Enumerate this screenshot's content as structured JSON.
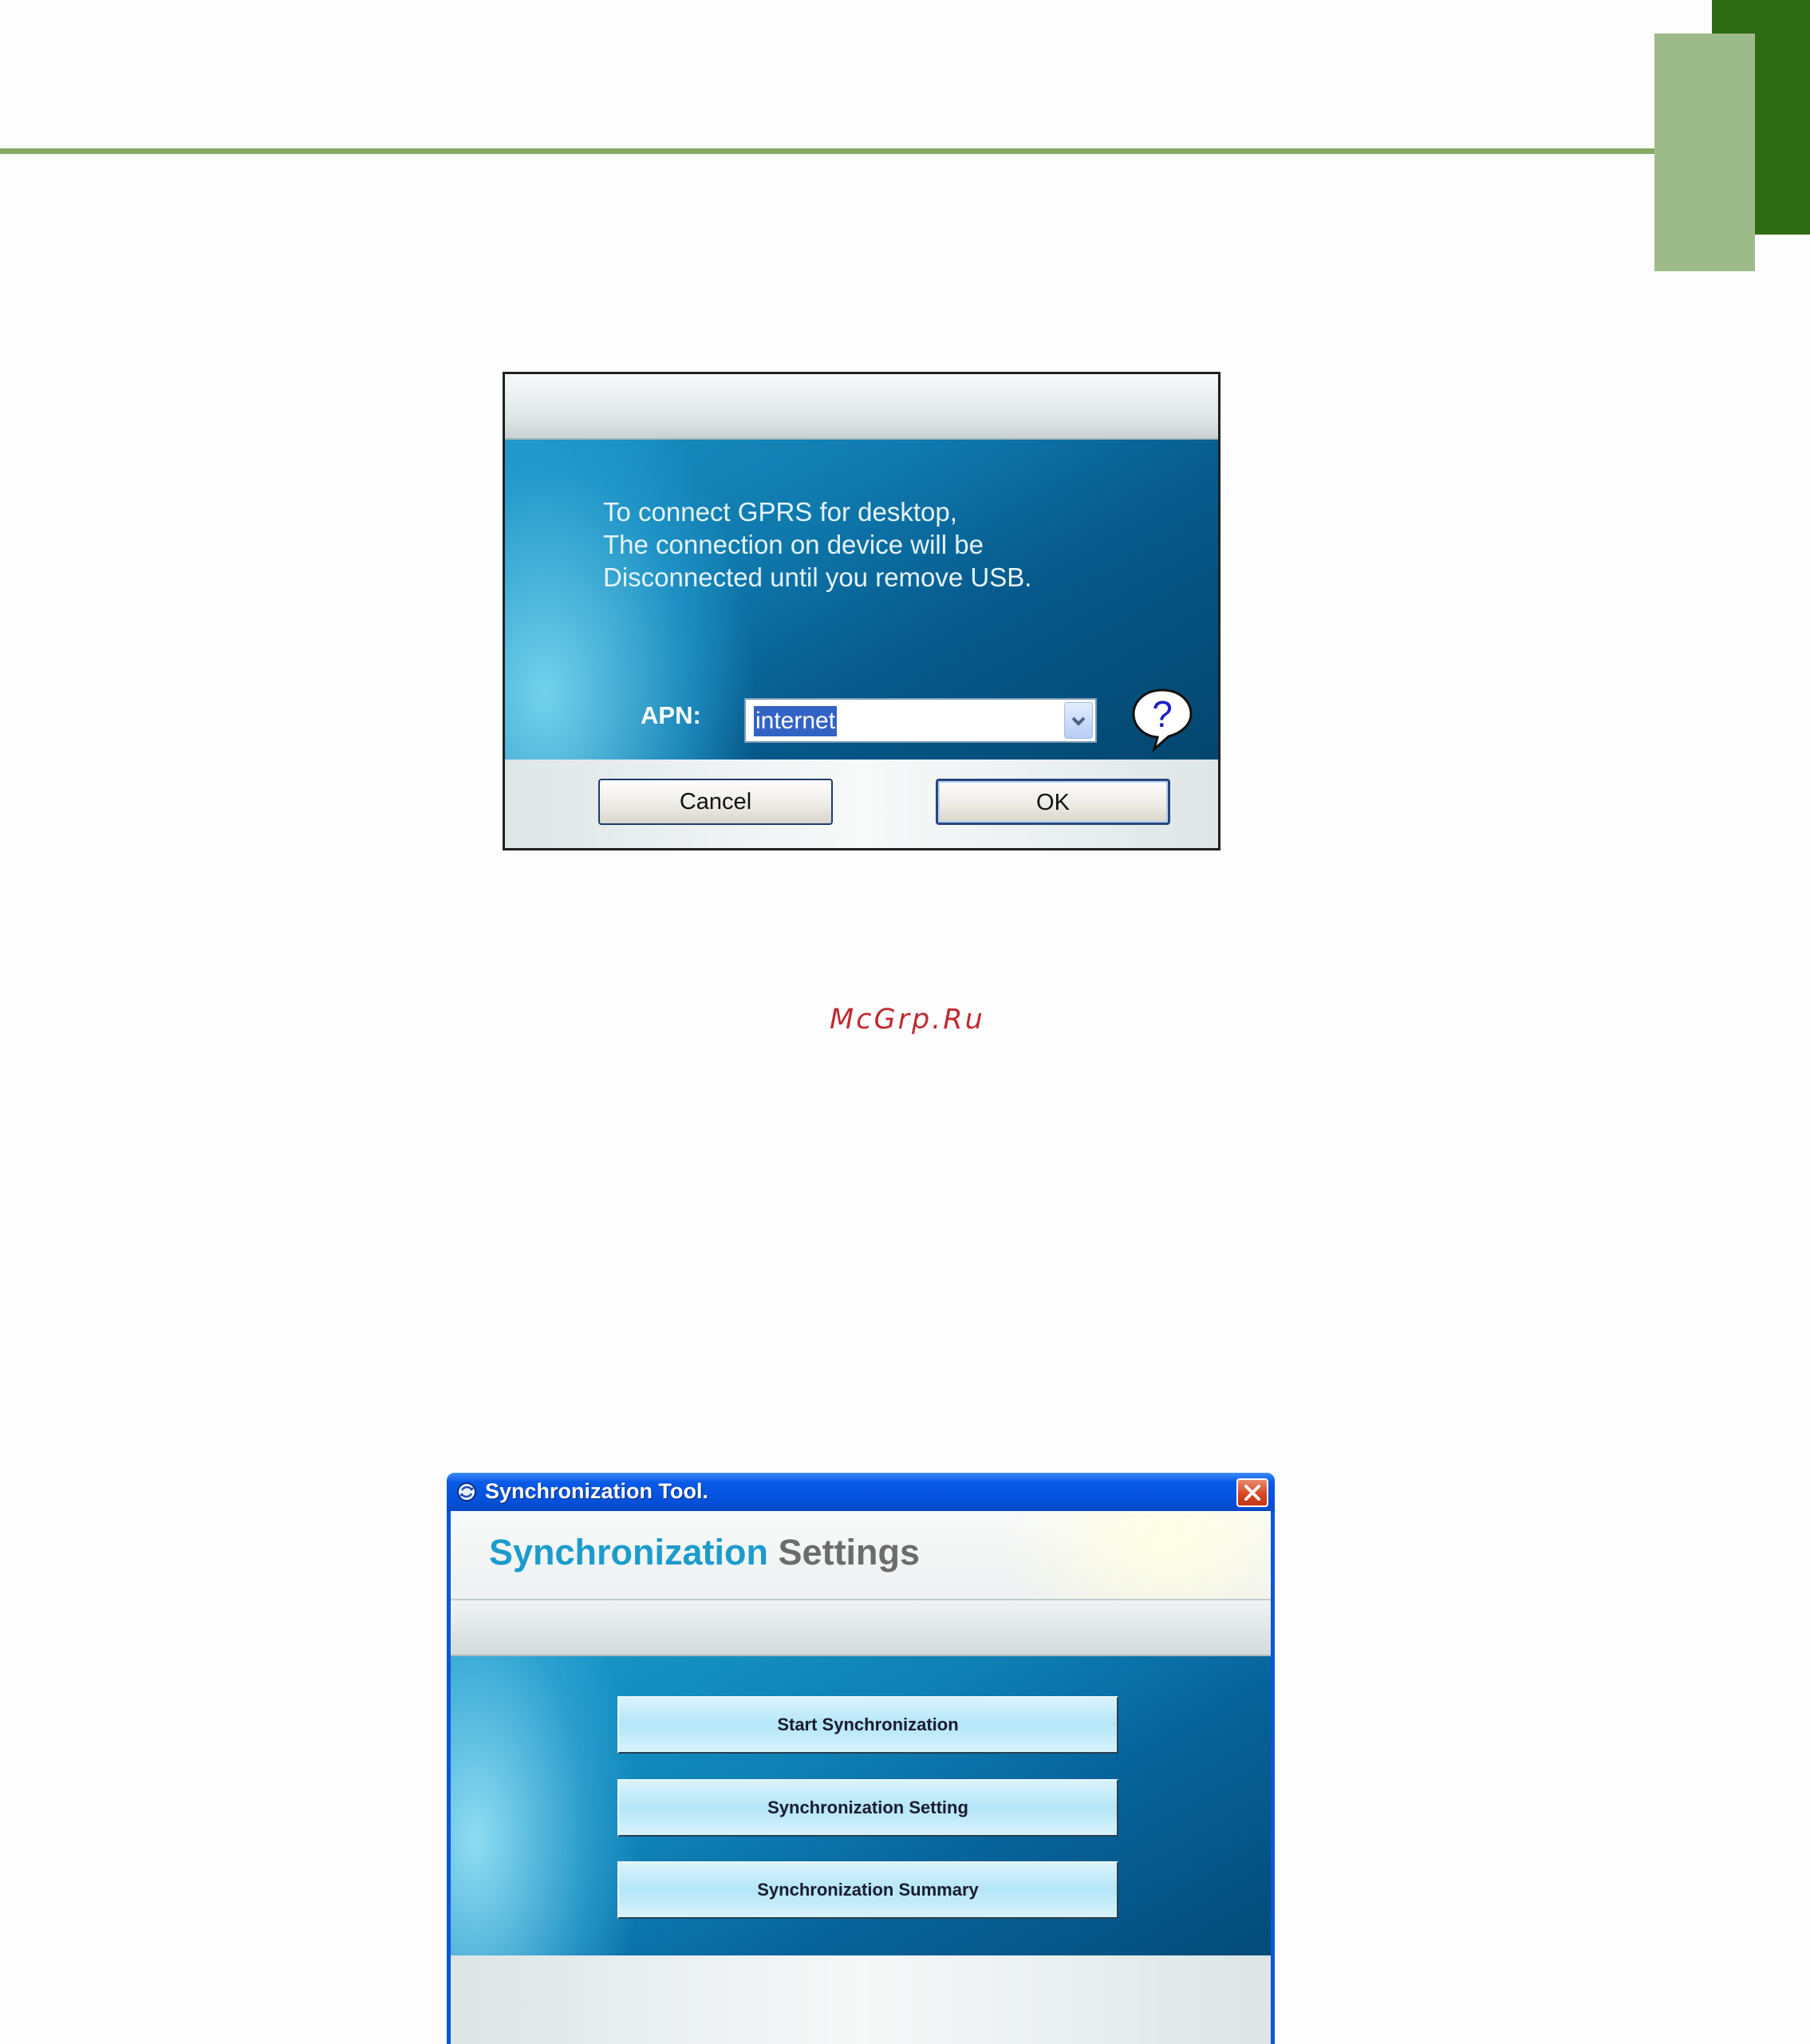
{
  "colors": {
    "accent_green_dark": "#2e6b13",
    "accent_green_light": "#9dbb89",
    "rule_line": "#86a863"
  },
  "apn_dialog": {
    "message": "To connect GPRS for desktop,\nThe connection on device will be\nDisconnected until you remove USB.",
    "apn_label": "APN:",
    "apn_value": "internet",
    "help_icon": "question-balloon-icon",
    "cancel_label": "Cancel",
    "ok_label": "OK"
  },
  "watermark": "McGrp.Ru",
  "sync_window": {
    "title": "Synchronization Tool.",
    "app_icon": "sync-globe-icon",
    "close_icon": "close-x-icon",
    "heading_part1": "Synchronization",
    "heading_part2": "Settings",
    "buttons": [
      {
        "label": "Start Synchronization"
      },
      {
        "label": "Synchronization Setting"
      },
      {
        "label": "Synchronization Summary"
      }
    ]
  }
}
